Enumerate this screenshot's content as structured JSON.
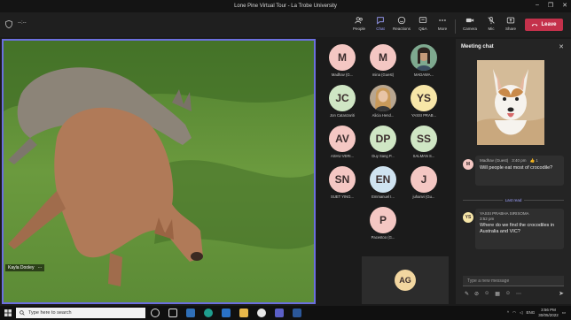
{
  "window": {
    "title": "Lone Pine Virtual Tour - La Trobe University",
    "controls": [
      "–",
      "❐",
      "✕"
    ]
  },
  "toolbar": {
    "timer": "--:--",
    "buttons": [
      {
        "label": "People",
        "icon": "people-icon"
      },
      {
        "label": "Chat",
        "icon": "chat-icon",
        "active": true
      },
      {
        "label": "Reactions",
        "icon": "reactions-icon"
      },
      {
        "label": "Q&A",
        "icon": "qa-icon"
      },
      {
        "label": "More",
        "icon": "more-icon"
      },
      {
        "label": "Camera",
        "icon": "camera-icon"
      },
      {
        "label": "Mic",
        "icon": "mic-off-icon"
      },
      {
        "label": "Share",
        "icon": "share-icon"
      }
    ],
    "leave_label": "Leave"
  },
  "stage": {
    "speaker_name": "Kayla Dooley",
    "more": "···"
  },
  "participants": [
    {
      "initials": "M",
      "name": "Madhav (G...",
      "color": "#f4c7c3"
    },
    {
      "initials": "M",
      "name": "mina (Guest)",
      "color": "#f4c7c3"
    },
    {
      "initials": "",
      "name": "MADAWA...",
      "color": "#8fb7a0",
      "photo": true
    },
    {
      "initials": "JC",
      "name": "Jon Catanzariti",
      "color": "#cfe6c4"
    },
    {
      "initials": "",
      "name": "Alicia Hend...",
      "color": "#c49a6c",
      "photo": true
    },
    {
      "initials": "YS",
      "name": "YASSI PRAB...",
      "color": "#f7e6a8"
    },
    {
      "initials": "AV",
      "name": "ASHU VERI...",
      "color": "#f4c7c3"
    },
    {
      "initials": "DP",
      "name": "Duy Sang P...",
      "color": "#cfe6c4"
    },
    {
      "initials": "SS",
      "name": "SALMAN S...",
      "color": "#cfe6c4"
    },
    {
      "initials": "SN",
      "name": "SUET YING...",
      "color": "#f4c7c3"
    },
    {
      "initials": "EN",
      "name": "Emmanuel I...",
      "color": "#cfe3f0"
    },
    {
      "initials": "J",
      "name": "juhanvi (Gu...",
      "color": "#f4c7c3"
    },
    {
      "initials": "P",
      "name": "Pacestoo (G...",
      "color": "#f4c7c3"
    }
  ],
  "self_view": {
    "initials": "AG",
    "color": "#f2d6a0"
  },
  "chat": {
    "title": "Meeting chat",
    "messages": [
      {
        "initials": "M",
        "author": "Madhav (Guest)",
        "time": "3:40 pm",
        "reaction": "👍 1",
        "text": "Will people eat most of crocodile?",
        "color": "#f4c7c3"
      },
      {
        "initials": "YS",
        "author": "YASSI PRABHA SIRISOMA",
        "time": "3:52 pm",
        "text": "Where do we find the crocodiles in Australia and VIC?",
        "color": "#f7e6a8"
      }
    ],
    "last_read": "Last read",
    "compose_placeholder": "Type a new message",
    "compose_tools": [
      "✎",
      "⊘",
      "☺",
      "▦",
      "☺",
      "⋯"
    ],
    "send": "➤"
  },
  "taskbar": {
    "search_placeholder": "Type here to search",
    "tray_lang": "ENG",
    "time": "3:56 PM",
    "date": "30/05/2022"
  },
  "colors": {
    "accent": "#6b6fde",
    "leave": "#c4314b"
  }
}
